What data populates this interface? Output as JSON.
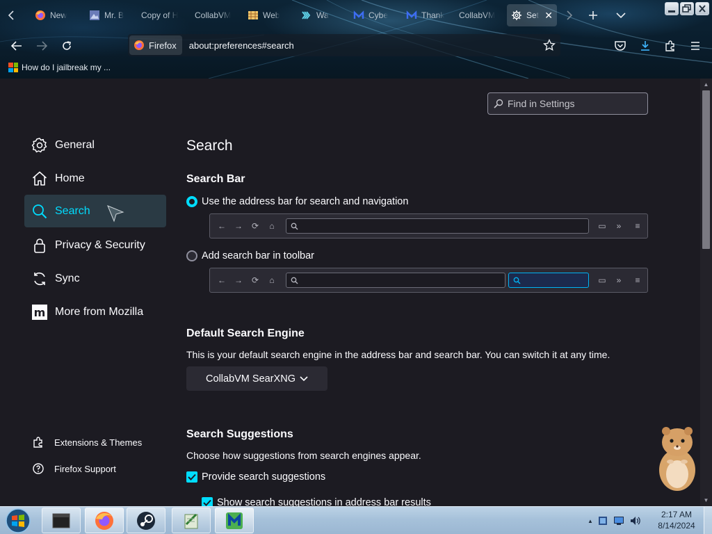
{
  "browser": {
    "tabs": [
      {
        "label": "New",
        "icon": "firefox-icon"
      },
      {
        "label": "Mr. B",
        "icon": "image-icon"
      },
      {
        "label": "Copy of H",
        "icon": ""
      },
      {
        "label": "CollabVM",
        "icon": ""
      },
      {
        "label": "Web",
        "icon": "web-icon"
      },
      {
        "label": "Wa",
        "icon": "wave-icon"
      },
      {
        "label": "Cybe",
        "icon": "m-icon"
      },
      {
        "label": "Thank",
        "icon": "m-icon"
      },
      {
        "label": "CollabVM",
        "icon": ""
      },
      {
        "label": "Sett",
        "icon": "gear-icon",
        "active": true
      }
    ],
    "identity_label": "Firefox",
    "url": "about:preferences#search",
    "bookmark": "How do I jailbreak my ..."
  },
  "settings": {
    "find_placeholder": "Find in Settings",
    "categories": [
      {
        "label": "General",
        "icon": "gear-icon"
      },
      {
        "label": "Home",
        "icon": "home-icon"
      },
      {
        "label": "Search",
        "icon": "search-icon",
        "selected": true
      },
      {
        "label": "Privacy & Security",
        "icon": "lock-icon"
      },
      {
        "label": "Sync",
        "icon": "sync-icon"
      },
      {
        "label": "More from Mozilla",
        "icon": "mozilla-icon"
      }
    ],
    "footer": [
      {
        "label": "Extensions & Themes",
        "icon": "puzzle-icon"
      },
      {
        "label": "Firefox Support",
        "icon": "help-icon"
      }
    ],
    "page_title": "Search",
    "search_bar": {
      "heading": "Search Bar",
      "option_address": "Use the address bar for search and navigation",
      "option_toolbar": "Add search bar in toolbar",
      "selected": "address"
    },
    "default_engine": {
      "heading": "Default Search Engine",
      "description": "This is your default search engine in the address bar and search bar. You can switch it at any time.",
      "selected": "CollabVM SearXNG"
    },
    "suggestions": {
      "heading": "Search Suggestions",
      "description": "Choose how suggestions from search engines appear.",
      "provide_label": "Provide search suggestions",
      "provide_checked": true,
      "address_bar_label": "Show search suggestions in address bar results",
      "address_bar_checked": true
    }
  },
  "taskbar": {
    "clock_time": "2:17 AM",
    "clock_date": "8/14/2024"
  },
  "colors": {
    "accent": "#00ddff",
    "background": "#1c1b22",
    "taskbar": "#a6c1da"
  }
}
